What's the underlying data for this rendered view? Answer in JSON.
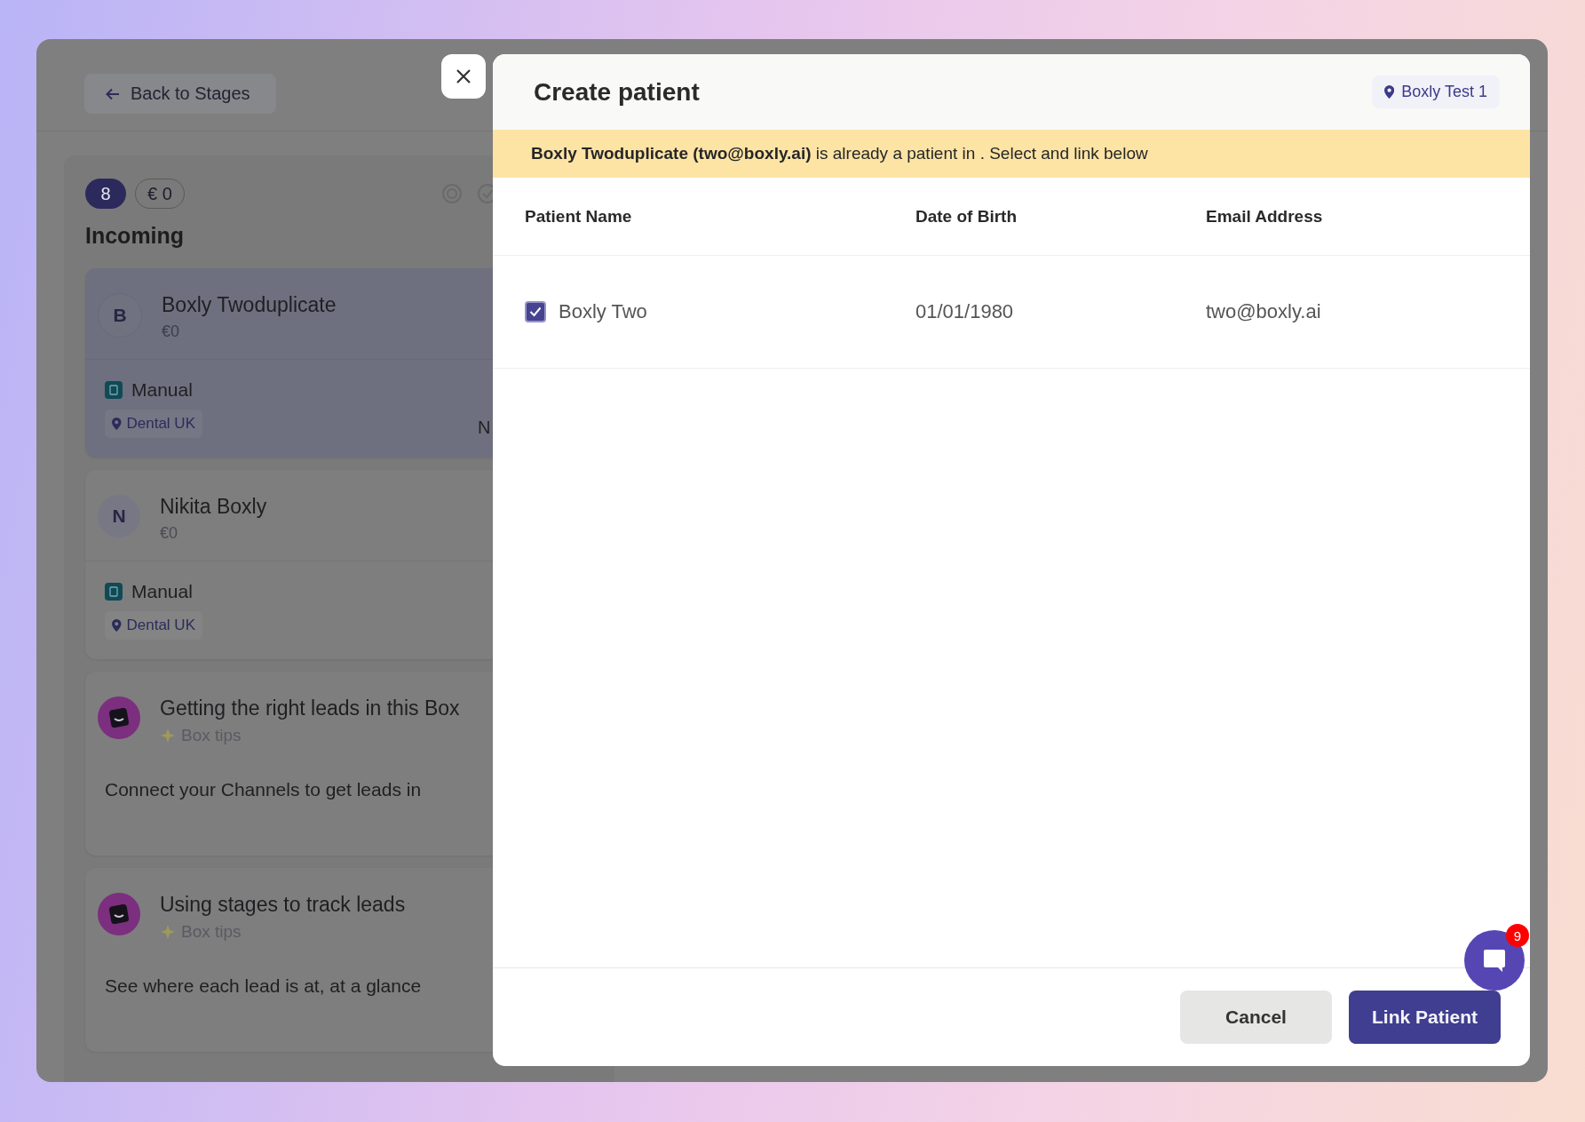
{
  "back_button": "Back to Stages",
  "stage": {
    "count": "8",
    "value": "€ 0",
    "title": "Incoming"
  },
  "cards": [
    {
      "kind": "lead",
      "selected": true,
      "initial": "B",
      "name": "Boxly Twoduplicate",
      "amount": "€0",
      "source": "Manual",
      "location": "Dental UK",
      "trailing": "N"
    },
    {
      "kind": "lead",
      "selected": false,
      "initial": "N",
      "name": "Nikita Boxly",
      "amount": "€0",
      "source": "Manual",
      "location": "Dental UK"
    },
    {
      "kind": "tip",
      "title": "Getting the right leads in this Box",
      "label": "Box tips",
      "body": "Connect your Channels to get leads in"
    },
    {
      "kind": "tip",
      "title": "Using stages to track leads",
      "label": "Box tips",
      "body": "See where each lead is at, at a glance"
    }
  ],
  "modal": {
    "title": "Create patient",
    "location": "Boxly Test 1",
    "notice": "**Boxly Twoduplicate (two@boxly.ai)** is already a patient in . Select and link below",
    "columns": [
      "Patient Name",
      "Date of Birth",
      "Email Address"
    ],
    "rows": [
      {
        "selected": true,
        "name": "Boxly Two",
        "dob": "01/01/1980",
        "email": "two@boxly.ai"
      }
    ],
    "buttons": [
      {
        "label": "Cancel",
        "kind": "secondary"
      },
      {
        "label": "Link Patient",
        "kind": "primary"
      }
    ]
  },
  "chat": {
    "badge": "9"
  }
}
